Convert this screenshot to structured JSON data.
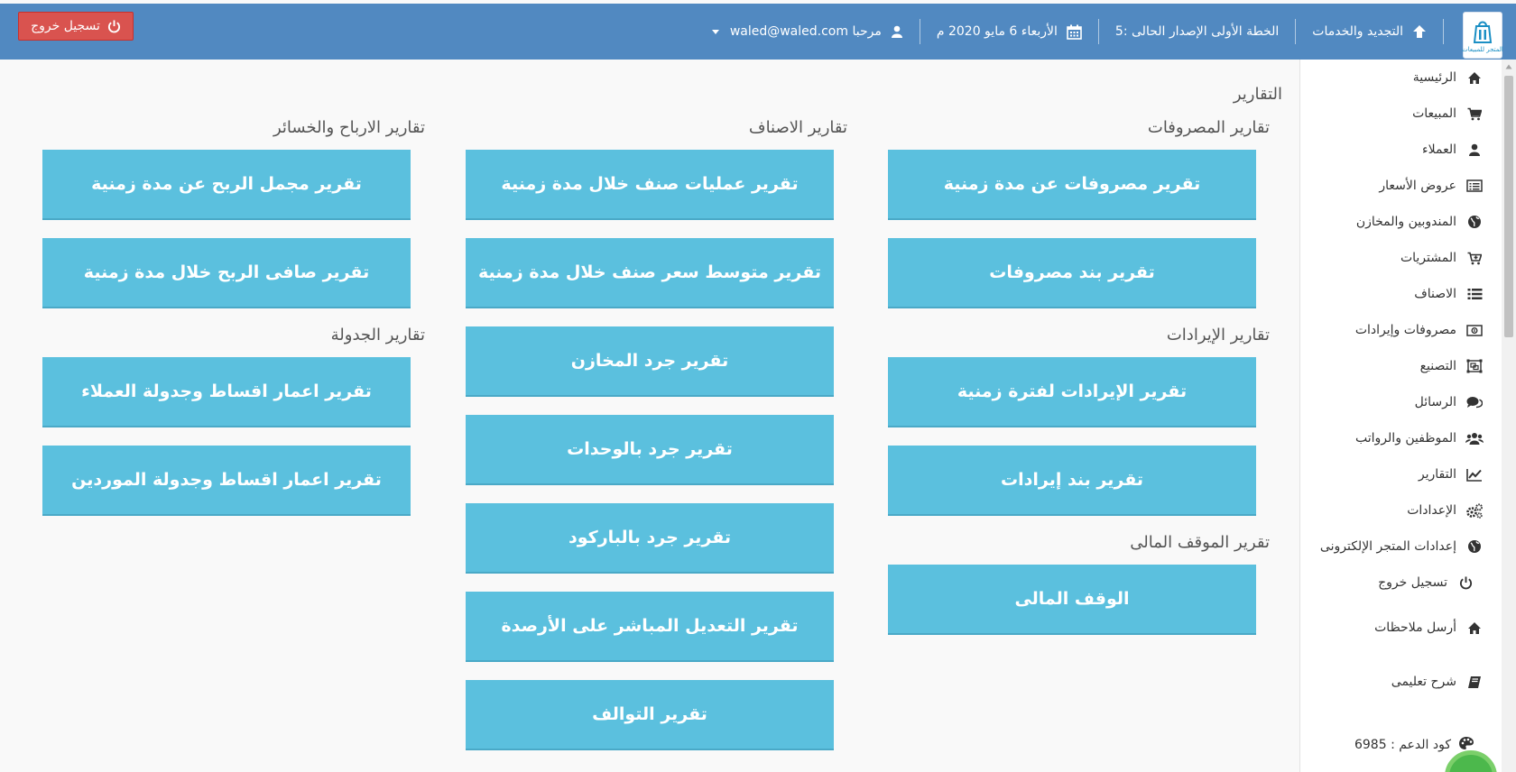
{
  "topbar": {
    "logo_text": "المتجر للمبيعات",
    "updates": "التجديد والخدمات",
    "plan": "الخطة الأولى الإصدار الحالى :5",
    "date": "الأربعاء 6 مايو 2020 م",
    "welcome": "مرحبا waled@waled.com",
    "logout": "تسجيل خروج"
  },
  "sidebar": {
    "items": [
      {
        "label": "الرئيسية",
        "icon": "home-icon"
      },
      {
        "label": "المبيعات",
        "icon": "cart-icon"
      },
      {
        "label": "العملاء",
        "icon": "user-icon"
      },
      {
        "label": "عروض الأسعار",
        "icon": "list-alt-icon"
      },
      {
        "label": "المندوبين والمخازن",
        "icon": "globe-icon"
      },
      {
        "label": "المشتريات",
        "icon": "cart-plus-icon"
      },
      {
        "label": "الاصناف",
        "icon": "list-icon"
      },
      {
        "label": "مصروفات وإيرادات",
        "icon": "money-icon"
      },
      {
        "label": "التصنيع",
        "icon": "object-group-icon"
      },
      {
        "label": "الرسائل",
        "icon": "comments-icon"
      },
      {
        "label": "الموظفين والرواتب",
        "icon": "users-icon"
      },
      {
        "label": "التقارير",
        "icon": "chart-line-icon"
      },
      {
        "label": "الإعدادات",
        "icon": "gears-icon"
      },
      {
        "label": "إعدادات المتجر الإلكترونى",
        "icon": "globe-icon"
      },
      {
        "label": "تسجيل خروج",
        "icon": "power-icon"
      }
    ],
    "feedback": "أرسل ملاحظات",
    "tutorial": "شرح تعليمى",
    "support_code": "كود الدعم : 6985"
  },
  "main": {
    "page_title": "التقارير",
    "sections": {
      "expenses": "تقارير المصروفات",
      "items": "تقارير الاصناف",
      "profit": "تقارير الارباح والخسائر",
      "revenues": "تقارير الإيرادات",
      "schedule": "تقارير الجدولة",
      "financial": "تقرير الموقف المالى"
    },
    "buttons": {
      "expenses_period": "تقرير مصروفات عن مدة زمنية",
      "expense_item": "تقرير بند مصروفات",
      "revenues_period": "تقرير الإيرادات لفترة زمنية",
      "revenue_item": "تقرير بند إيرادات",
      "financial_position": "الوقف المالى",
      "item_operations": "تقرير عمليات صنف خلال مدة زمنية",
      "avg_price": "تقرير متوسط سعر صنف خلال مدة زمنية",
      "stores_inventory": "تقرير جرد المخازن",
      "units_inventory": "تقرير جرد بالوحدات",
      "barcode_inventory": "تقرير جرد بالباركود",
      "direct_adjustment": "تقرير التعديل المباشر على الأرصدة",
      "damaged": "تقرير التوالف",
      "gross_profit": "تقرير مجمل الربح عن مدة زمنية",
      "net_profit": "تقرير صافى الربح خلال مدة زمنية",
      "customer_aging": "تقرير اعمار اقساط وجدولة العملاء",
      "supplier_aging": "تقرير اعمار اقساط وجدولة الموردين"
    }
  },
  "colors": {
    "topbar": "#5189c1",
    "button": "#5bc0de",
    "logout": "#d9534f"
  }
}
